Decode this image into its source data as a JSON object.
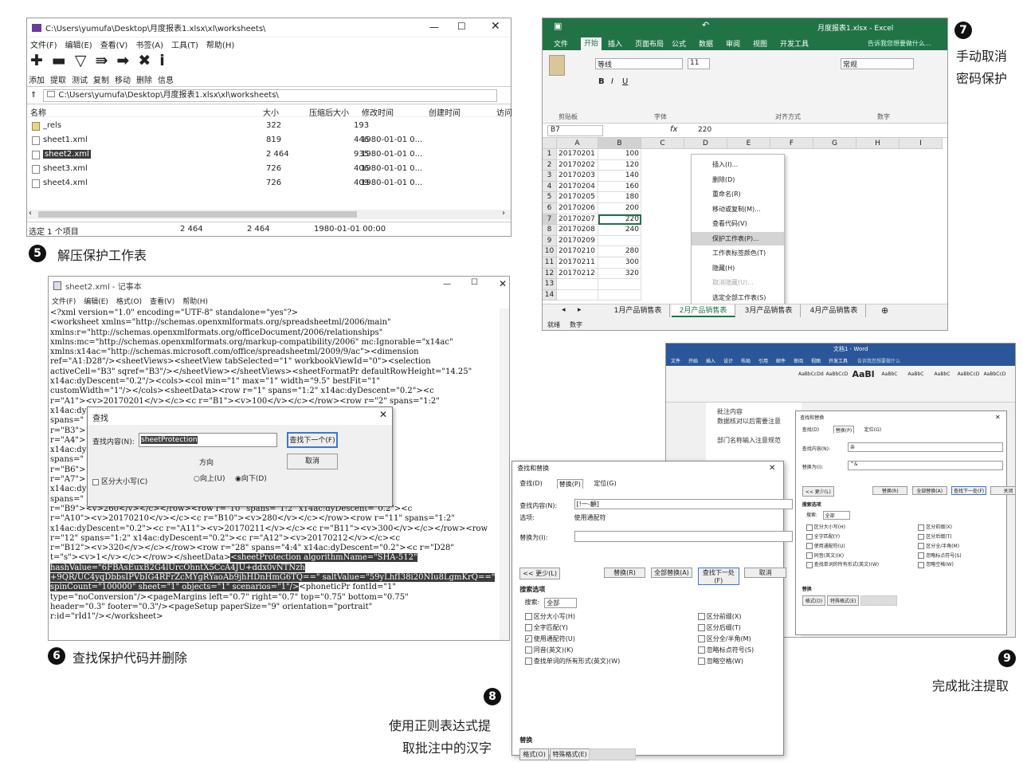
{
  "winrar": {
    "title": "C:\\Users\\yumufa\\Desktop\\月度报表1.xlsx\\xl\\worksheets\\",
    "menu": [
      "文件(F)",
      "编辑(E)",
      "查看(V)",
      "书签(A)",
      "工具(T)",
      "帮助(H)"
    ],
    "toolbar": [
      "添加",
      "提取",
      "测试",
      "复制",
      "移动",
      "删除",
      "信息"
    ],
    "path": "C:\\Users\\yumufa\\Desktop\\月度报表1.xlsx\\xl\\worksheets\\",
    "columns": [
      "名称",
      "大小",
      "压缩后大小",
      "修改时间",
      "创建时间",
      "访问"
    ],
    "rows": [
      {
        "name": "_rels",
        "size": "322",
        "packed": "193",
        "mtime": ""
      },
      {
        "name": "sheet1.xml",
        "size": "819",
        "packed": "446",
        "mtime": "1980-01-01 0..."
      },
      {
        "name": "sheet2.xml",
        "size": "2 464",
        "packed": "935",
        "mtime": "1980-01-01 0..."
      },
      {
        "name": "sheet3.xml",
        "size": "726",
        "packed": "406",
        "mtime": "1980-01-01 0..."
      },
      {
        "name": "sheet4.xml",
        "size": "726",
        "packed": "409",
        "mtime": "1980-01-01 0..."
      }
    ],
    "status": [
      "选定 1 个项目",
      "2 464",
      "2 464",
      "1980-01-01 00:00"
    ]
  },
  "captions": {
    "c5": "解压保护工作表",
    "c6": "查找保护代码并删除",
    "c7a": "手动取消",
    "c7b": "密码保护",
    "c8a": "使用正则表达式提",
    "c8b": "取批注中的汉字",
    "c9": "完成批注提取",
    "n5": "5",
    "n6": "6",
    "n7": "7",
    "n8": "8",
    "n9": "9"
  },
  "notepad": {
    "title": "sheet2.xml - 记事本",
    "menu": [
      "文件(F)",
      "编辑(E)",
      "格式(O)",
      "查看(V)",
      "帮助(H)"
    ],
    "lines": [
      "<?xml version=\"1.0\" encoding=\"UTF-8\" standalone=\"yes\"?>",
      "<worksheet xmlns=\"http://schemas.openxmlformats.org/spreadsheetml/2006/main\"",
      "xmlns:r=\"http://schemas.openxmlformats.org/officeDocument/2006/relationships\"",
      "xmlns:mc=\"http://schemas.openxmlformats.org/markup-compatibility/2006\" mc:Ignorable=\"x14ac\"",
      "xmlns:x14ac=\"http://schemas.microsoft.com/office/spreadsheetml/2009/9/ac\"><dimension",
      "ref=\"A1:D28\"/><sheetViews><sheetView tabSelected=\"1\" workbookViewId=\"0\"><selection",
      "activeCell=\"B3\" sqref=\"B3\"/></sheetView></sheetViews><sheetFormatPr defaultRowHeight=\"14.25\"",
      "x14ac:dyDescent=\"0.2\"/><cols><col min=\"1\" max=\"1\" width=\"9.5\" bestFit=\"1\"",
      "customWidth=\"1\"/></cols><sheetData><row r=\"1\" spans=\"1:2\" x14ac:dyDescent=\"0.2\"><c",
      "r=\"A1\"><v>20170201</v></c><c r=\"B1\"><v>100</v></c></row><row r=\"2\" spans=\"1:2\"",
      "x14ac:dy                                        <v>120</v></c></row><row r=\"3\"",
      "spans=\"                                         scent=\"0.2\"><c",
      "r=\"B3\">                                        <v>160</v></c></row><row r=\"5\" spans=\"1:2\"",
      "r=\"A4\">                                        ow r=\"5\" spans=\"1:2\"",
      "x14ac:dy                                        <v>180</v></c></row><row r=\"6\"",
      "spans=\"                                         </c><c",
      "r=\"B6\">                                        scent=\"0.2\"><c",
      "r=\"A7\">                                        r=\"8\" spans=\"1:2\"",
      "x14ac:dy                                        <v>240</v></c></row><row r=\"9\"",
      "spans=\"                                         </c><c",
      "r=\"B9\"><v>260</v></c></row><row r=\"10\" spans=\"1:2\" x14ac:dyDescent=\"0.2\"><c",
      "r=\"A10\"><v>20170210</v></c><c r=\"B10\"><v>280</v></c></row><row r=\"11\" spans=\"1:2\"",
      "x14ac:dyDescent=\"0.2\"><c r=\"A11\"><v>20170211</v></c><c r=\"B11\"><v>300</v></c></row><row",
      "r=\"12\" spans=\"1:2\" x14ac:dyDescent=\"0.2\"><c r=\"A12\"><v>20170212</v></c><c",
      "r=\"B12\"><v>320</v></c></row><row r=\"28\" spans=\"4:4\" x14ac:dyDescent=\"0.2\"><c r=\"D28\"",
      "t=\"s\"><v>1</v></c></row></sheetData>"
    ],
    "sel_lines": [
      "<sheetProtection algorithmName=\"SHA-512\"",
      "hashValue=\"6FBAsEuxB2G4lUrcOhntX5CcA4JU+ddx0vNTNzh",
      "+9QR/UC4yqDbbsIPVbIG4RFrZcMYgRYaoAb9jhHDnHmG6TQ==\" saltValue=\"59yLhfI38i20NIu8LgmKrQ==\"",
      "spinCount=\"100000\" sheet=\"1\" objects=\"1\" scenarios=\"1\"/>"
    ],
    "tail_lines": [
      "type=\"noConversion\"/><pageMargins left=\"0.7\" right=\"0.7\" top=\"0.75\" bottom=\"0.75\"",
      "header=\"0.3\" footer=\"0.3\"/><pageSetup paperSize=\"9\" orientation=\"portrait\"",
      "r:id=\"rId1\"/></worksheet>"
    ],
    "phonetic": "<phoneticPr fontId=\"1\"",
    "find": {
      "title": "查找",
      "label": "查找内容(N):",
      "value": "sheetProtection",
      "next": "查找下一个(F)",
      "cancel": "取消",
      "direction": "方向",
      "up": "向上(U)",
      "down": "向下(D)",
      "case": "区分大小写(C)"
    }
  },
  "excel": {
    "title": "月度报表1.xlsx - Excel",
    "tabs": [
      "文件",
      "开始",
      "插入",
      "页面布局",
      "公式",
      "数据",
      "审阅",
      "视图",
      "开发工具"
    ],
    "tellme": "告诉我您想要做什么...",
    "font": "等线",
    "size": "11",
    "numfmt": "常规",
    "groups": [
      "剪贴板",
      "字体",
      "对齐方式",
      "数字"
    ],
    "namebox": "B7",
    "formula": "220",
    "col_headers": [
      "A",
      "B",
      "C",
      "D",
      "E",
      "F",
      "G",
      "H",
      "I"
    ],
    "rows": [
      [
        "1",
        "20170201",
        "100"
      ],
      [
        "2",
        "20170202",
        "120"
      ],
      [
        "3",
        "20170203",
        "140"
      ],
      [
        "4",
        "20170204",
        "160"
      ],
      [
        "5",
        "20170205",
        "180"
      ],
      [
        "6",
        "20170206",
        "200"
      ],
      [
        "7",
        "20170207",
        "220"
      ],
      [
        "8",
        "20170208",
        "240"
      ],
      [
        "9",
        "20170209",
        ""
      ],
      [
        "10",
        "20170210",
        "280"
      ],
      [
        "11",
        "20170211",
        "300"
      ],
      [
        "12",
        "20170212",
        "320"
      ],
      [
        "13",
        "",
        ""
      ],
      [
        "14",
        "",
        ""
      ]
    ],
    "context": [
      "插入(I)...",
      "删除(D)",
      "重命名(R)",
      "移动或复制(M)...",
      "查看代码(V)",
      "保护工作表(P)...",
      "工作表标签颜色(T)",
      "隐藏(H)",
      "取消隐藏(U)...",
      "选定全部工作表(S)"
    ],
    "sheets": [
      "1月产品销售表",
      "2月产品销售表",
      "3月产品销售表",
      "4月产品销售表"
    ],
    "status": [
      "就绪",
      "数字"
    ]
  },
  "word": {
    "title": "文档1 - Word",
    "tabs": [
      "文件",
      "开始",
      "插入",
      "设计",
      "布局",
      "引用",
      "邮件",
      "审阅",
      "视图",
      "开发工具"
    ],
    "tellme": "告诉我您想要做什么",
    "styles": [
      "AaBbCcDd",
      "AaBbCcD",
      "AaBl",
      "AaBbC",
      "AaBbC",
      "AaBbC",
      "AaBbCcD",
      "AaBbCcD"
    ],
    "body": [
      "批注内容",
      "数据核对以后需要注意",
      "部门名称输入注意规范"
    ],
    "fr_back": {
      "title": "查找和替换",
      "tabs": [
        "查找(D)",
        "替换(P)",
        "定位(G)"
      ],
      "find_label": "查找内容(N):",
      "find_value": "亲",
      "replace_label": "替换为(I):",
      "replace_value": "^&",
      "less": "<< 更少(L)",
      "buttons": [
        "替换(R)",
        "全部替换(A)",
        "查找下一处(F)",
        "关闭"
      ],
      "opts": "搜索选项",
      "search": "搜索:",
      "scope": "全部",
      "left_opts": [
        "区分大小写(H)",
        "全字匹配(Y)",
        "使用通配符(U)",
        "同音(英文)(K)",
        "查找单词的所有形式(英文)(W)"
      ],
      "right_opts": [
        "区分前缀(X)",
        "区分后缀(T)",
        "区分全/半角(M)",
        "忽略标点符号(S)",
        "忽略空格(W)"
      ],
      "replace": "替换",
      "fmt": "格式(O)",
      "special": "特殊格式(E)",
      "nofmt": "不限定格式(T)"
    },
    "fr_front": {
      "title": "查找和替换",
      "tabs": [
        "查找(D)",
        "替换(P)",
        "定位(G)"
      ],
      "find_label": "查找内容(N):",
      "find_value": "[!一-龥]",
      "options_label": "选项:",
      "options_value": "使用通配符",
      "replace_label": "替换为(I):",
      "replace_value": "",
      "less": "<< 更少(L)",
      "buttons": [
        "替换(R)",
        "全部替换(A)",
        "查找下一处(F)",
        "取消"
      ],
      "opts": "搜索选项",
      "search": "搜索:",
      "scope": "全部",
      "left_opts": [
        "区分大小写(H)",
        "全字匹配(Y)",
        "使用通配符(U)",
        "同音(英文)(K)",
        "查找单词的所有形式(英文)(W)"
      ],
      "right_opts": [
        "区分前缀(X)",
        "区分后缀(T)",
        "区分全/半角(M)",
        "忽略标点符号(S)",
        "忽略空格(W)"
      ],
      "replace": "替换",
      "fmt": "格式(O)",
      "special": "特殊格式(E)",
      "nofmt": "不限定格式(T)"
    }
  }
}
